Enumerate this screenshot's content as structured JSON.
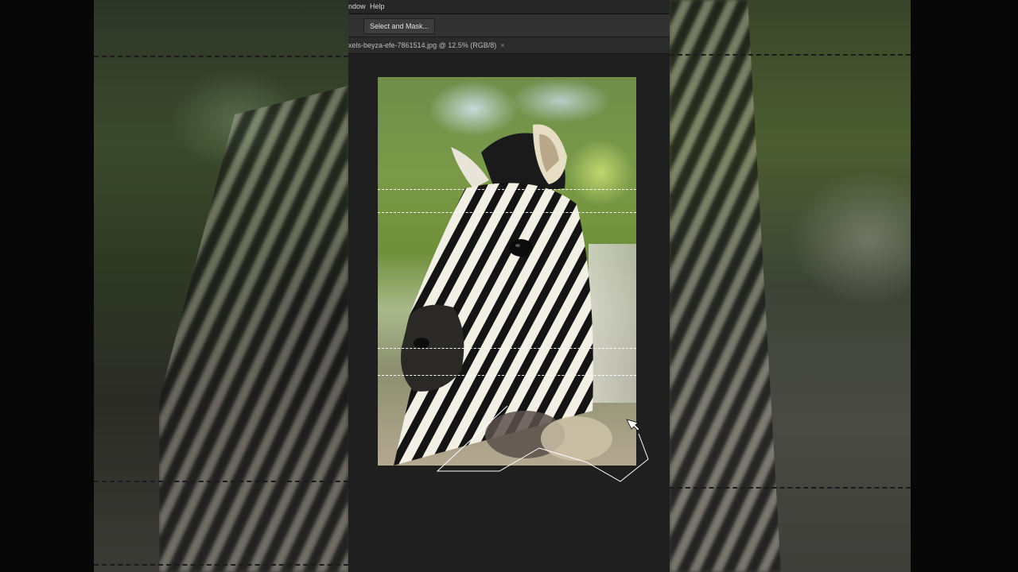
{
  "menu": {
    "window_partial": "ndow",
    "help": "Help"
  },
  "options": {
    "select_and_mask": "Select and Mask..."
  },
  "document": {
    "tab_title": "xels-beyza-efe-7861514.jpg @ 12.5% (RGB/8)",
    "close_symbol": "×"
  },
  "canvas": {
    "background": "#1f1f1f",
    "cursor": "polygonal-lasso-cursor-icon"
  },
  "colors": {
    "menu_bg": "#262626",
    "options_bg": "#323232",
    "selection_marquee": "#ffffff"
  }
}
